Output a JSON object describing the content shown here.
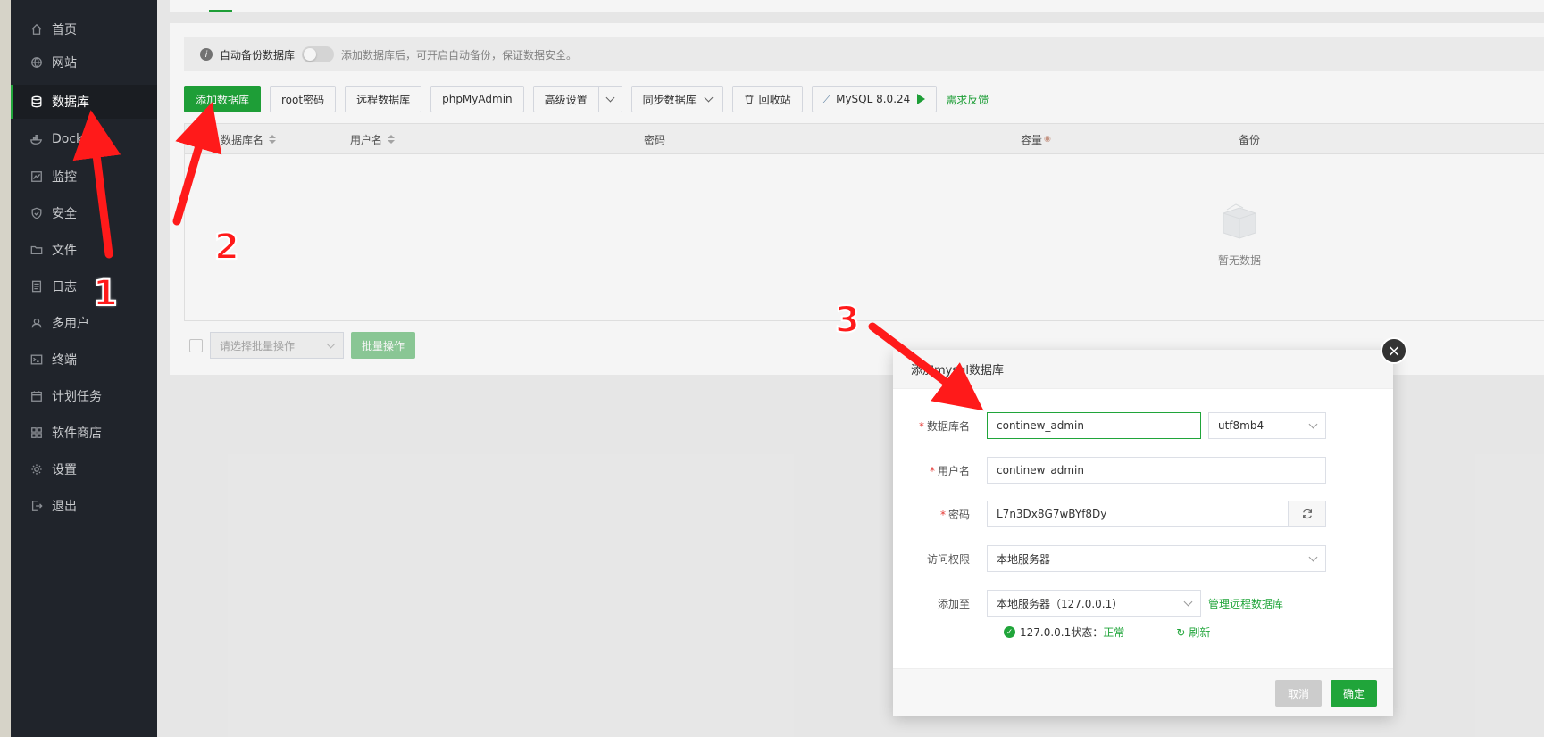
{
  "sidebar": {
    "items": [
      {
        "label": "首页",
        "icon": "home-icon"
      },
      {
        "label": "网站",
        "icon": "globe-icon"
      },
      {
        "label": "数据库",
        "icon": "database-icon",
        "active": true
      },
      {
        "label": "Docker",
        "icon": "docker-icon"
      },
      {
        "label": "监控",
        "icon": "monitor-icon"
      },
      {
        "label": "安全",
        "icon": "shield-icon"
      },
      {
        "label": "文件",
        "icon": "folder-icon"
      },
      {
        "label": "日志",
        "icon": "log-icon"
      },
      {
        "label": "多用户",
        "icon": "users-icon"
      },
      {
        "label": "终端",
        "icon": "terminal-icon"
      },
      {
        "label": "计划任务",
        "icon": "calendar-icon"
      },
      {
        "label": "软件商店",
        "icon": "apps-icon"
      },
      {
        "label": "设置",
        "icon": "gear-icon"
      },
      {
        "label": "退出",
        "icon": "logout-icon"
      }
    ]
  },
  "notice": {
    "label": "自动备份数据库",
    "desc": "添加数据库后，可开启自动备份，保证数据安全。"
  },
  "toolbar": {
    "add_db": "添加数据库",
    "root_pwd": "root密码",
    "remote_db": "远程数据库",
    "phpmyadmin": "phpMyAdmin",
    "advanced": "高级设置",
    "sync_db": "同步数据库",
    "recycle": "回收站",
    "mysql_version": "MySQL 8.0.24",
    "feedback": "需求反馈"
  },
  "table": {
    "columns": [
      "数据库名",
      "用户名",
      "密码",
      "容量",
      "备份"
    ],
    "empty_text": "暂无数据"
  },
  "batch": {
    "placeholder": "请选择批量操作",
    "button": "批量操作"
  },
  "modal": {
    "title": "添加mysql数据库",
    "fields": {
      "db_name_label": "数据库名",
      "db_name_value": "continew_admin",
      "charset_value": "utf8mb4",
      "username_label": "用户名",
      "username_value": "continew_admin",
      "password_label": "密码",
      "password_value": "L7n3Dx8G7wBYf8Dy",
      "access_label": "访问权限",
      "access_value": "本地服务器",
      "add_to_label": "添加至",
      "add_to_value": "本地服务器（127.0.0.1）",
      "manage_remote": "管理远程数据库"
    },
    "status": {
      "prefix": "127.0.0.1状态：",
      "state": "正常",
      "refresh": "刷新"
    },
    "cancel": "取消",
    "confirm": "确定"
  },
  "annotations": {
    "one": "1",
    "two": "2",
    "three": "3"
  },
  "colors": {
    "accent": "#20a53a",
    "sidebar_bg": "#20242b",
    "annotation": "#ff1a1a"
  }
}
